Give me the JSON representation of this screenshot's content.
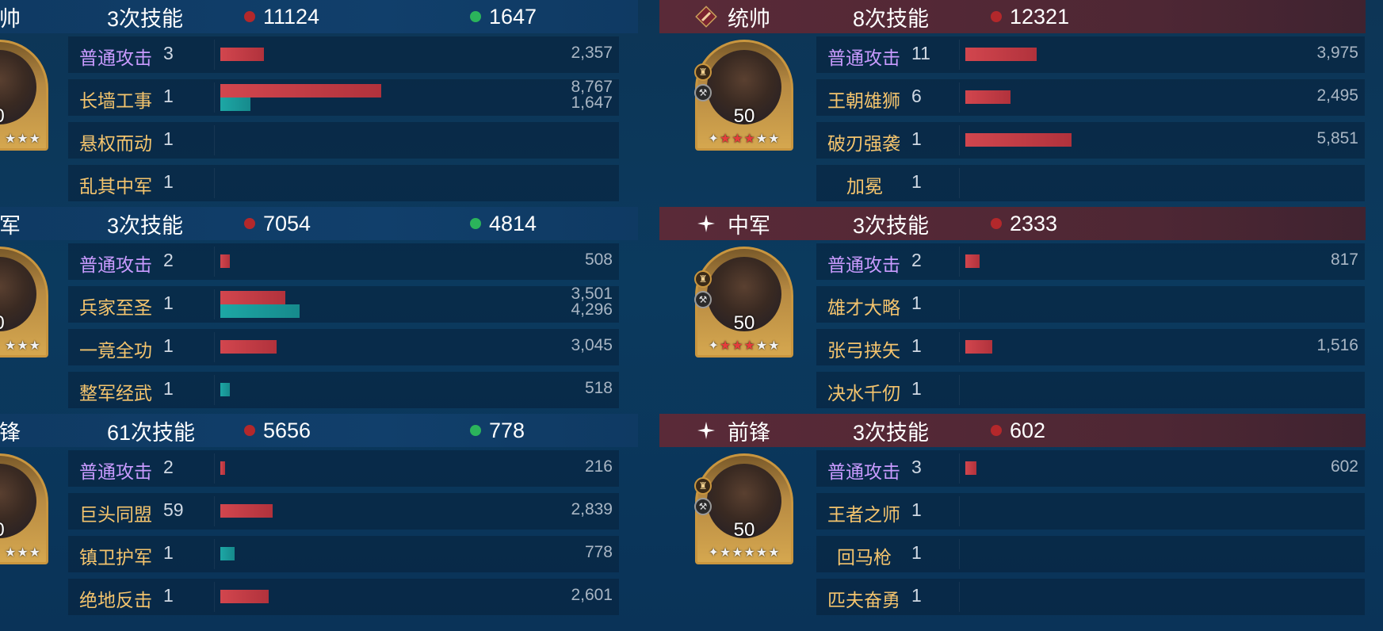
{
  "colors": {
    "damage": "#c1393f",
    "heal": "#1da7a5",
    "normal_attack": "#c99bff",
    "skill": "#f4c46d"
  },
  "left": {
    "sections": [
      {
        "role_label": "帅",
        "skill_count": "3次技能",
        "red_stat": "11124",
        "green_stat": "1647",
        "portrait": {
          "level": "0",
          "stars": "★★★"
        },
        "rows": [
          {
            "name": "普通攻击",
            "type": "normal",
            "count": "3",
            "values": [
              "2,357"
            ],
            "bars": [
              {
                "color": "red",
                "fraction": 0.069
              }
            ]
          },
          {
            "name": "长墙工事",
            "type": "skill",
            "count": "1",
            "values": [
              "8,767",
              "1,647"
            ],
            "bars": [
              {
                "color": "red",
                "fraction": 0.254
              },
              {
                "color": "teal",
                "fraction": 0.048
              }
            ]
          },
          {
            "name": "悬权而动",
            "type": "skill",
            "count": "1",
            "values": [],
            "bars": []
          },
          {
            "name": "乱其中军",
            "type": "skill",
            "count": "1",
            "values": [],
            "bars": []
          }
        ]
      },
      {
        "role_label": "军",
        "skill_count": "3次技能",
        "red_stat": "7054",
        "green_stat": "4814",
        "portrait": {
          "level": "0",
          "stars": "★★★"
        },
        "rows": [
          {
            "name": "普通攻击",
            "type": "normal",
            "count": "2",
            "values": [
              "508"
            ],
            "bars": [
              {
                "color": "red",
                "fraction": 0.015
              }
            ]
          },
          {
            "name": "兵家至圣",
            "type": "skill",
            "count": "1",
            "values": [
              "3,501",
              "4,296"
            ],
            "bars": [
              {
                "color": "red",
                "fraction": 0.102
              },
              {
                "color": "teal",
                "fraction": 0.125
              }
            ]
          },
          {
            "name": "一竟全功",
            "type": "skill",
            "count": "1",
            "values": [
              "3,045"
            ],
            "bars": [
              {
                "color": "red",
                "fraction": 0.089
              }
            ]
          },
          {
            "name": "整军经武",
            "type": "skill",
            "count": "1",
            "values": [
              "518"
            ],
            "bars": [
              {
                "color": "teal",
                "fraction": 0.015
              }
            ]
          }
        ]
      },
      {
        "role_label": "锋",
        "skill_count": "61次技能",
        "red_stat": "5656",
        "green_stat": "778",
        "portrait": {
          "level": "0",
          "stars": "★★★"
        },
        "rows": [
          {
            "name": "普通攻击",
            "type": "normal",
            "count": "2",
            "values": [
              "216"
            ],
            "bars": [
              {
                "color": "red",
                "fraction": 0.006
              }
            ]
          },
          {
            "name": "巨头同盟",
            "type": "skill",
            "count": "59",
            "values": [
              "2,839"
            ],
            "bars": [
              {
                "color": "red",
                "fraction": 0.083
              }
            ]
          },
          {
            "name": "镇卫护军",
            "type": "skill",
            "count": "1",
            "values": [
              "778"
            ],
            "bars": [
              {
                "color": "teal",
                "fraction": 0.023
              }
            ]
          },
          {
            "name": "绝地反击",
            "type": "skill",
            "count": "1",
            "values": [
              "2,601"
            ],
            "bars": [
              {
                "color": "red",
                "fraction": 0.076
              }
            ]
          }
        ]
      }
    ]
  },
  "right": {
    "sections": [
      {
        "role_label": "统帅",
        "skill_count": "8次技能",
        "red_stat": "12321",
        "icon": "commander-banner-icon",
        "portrait": {
          "level": "50",
          "stars": "✦★★★★★",
          "red_stars": 3
        },
        "rows": [
          {
            "name": "普通攻击",
            "type": "normal",
            "count": "11",
            "values": [
              "3,975"
            ],
            "bars": [
              {
                "color": "red",
                "fraction": 0.113
              }
            ]
          },
          {
            "name": "王朝雄狮",
            "type": "skill",
            "count": "6",
            "values": [
              "2,495"
            ],
            "bars": [
              {
                "color": "red",
                "fraction": 0.071
              }
            ]
          },
          {
            "name": "破刃强袭",
            "type": "skill",
            "count": "1",
            "values": [
              "5,851"
            ],
            "bars": [
              {
                "color": "red",
                "fraction": 0.167
              }
            ]
          },
          {
            "name": "加冕",
            "type": "skill",
            "count": "1",
            "values": [],
            "bars": []
          }
        ]
      },
      {
        "role_label": "中军",
        "skill_count": "3次技能",
        "red_stat": "2333",
        "icon": "sparkle-icon",
        "portrait": {
          "level": "50",
          "stars": "✦★★★★★",
          "red_stars": 3
        },
        "rows": [
          {
            "name": "普通攻击",
            "type": "normal",
            "count": "2",
            "values": [
              "817"
            ],
            "bars": [
              {
                "color": "red",
                "fraction": 0.023
              }
            ]
          },
          {
            "name": "雄才大略",
            "type": "skill",
            "count": "1",
            "values": [],
            "bars": []
          },
          {
            "name": "张弓挟矢",
            "type": "skill",
            "count": "1",
            "values": [
              "1,516"
            ],
            "bars": [
              {
                "color": "red",
                "fraction": 0.043
              }
            ]
          },
          {
            "name": "决水千仞",
            "type": "skill",
            "count": "1",
            "values": [],
            "bars": []
          }
        ]
      },
      {
        "role_label": "前锋",
        "skill_count": "3次技能",
        "red_stat": "602",
        "icon": "sparkle-icon",
        "portrait": {
          "level": "50",
          "stars": "✦★★★★★",
          "red_stars": 0
        },
        "rows": [
          {
            "name": "普通攻击",
            "type": "normal",
            "count": "3",
            "values": [
              "602"
            ],
            "bars": [
              {
                "color": "red",
                "fraction": 0.017
              }
            ]
          },
          {
            "name": "王者之师",
            "type": "skill",
            "count": "1",
            "values": [],
            "bars": []
          },
          {
            "name": "回马枪",
            "type": "skill",
            "count": "1",
            "values": [],
            "bars": []
          },
          {
            "name": "匹夫奋勇",
            "type": "skill",
            "count": "1",
            "values": [],
            "bars": []
          }
        ]
      }
    ]
  }
}
